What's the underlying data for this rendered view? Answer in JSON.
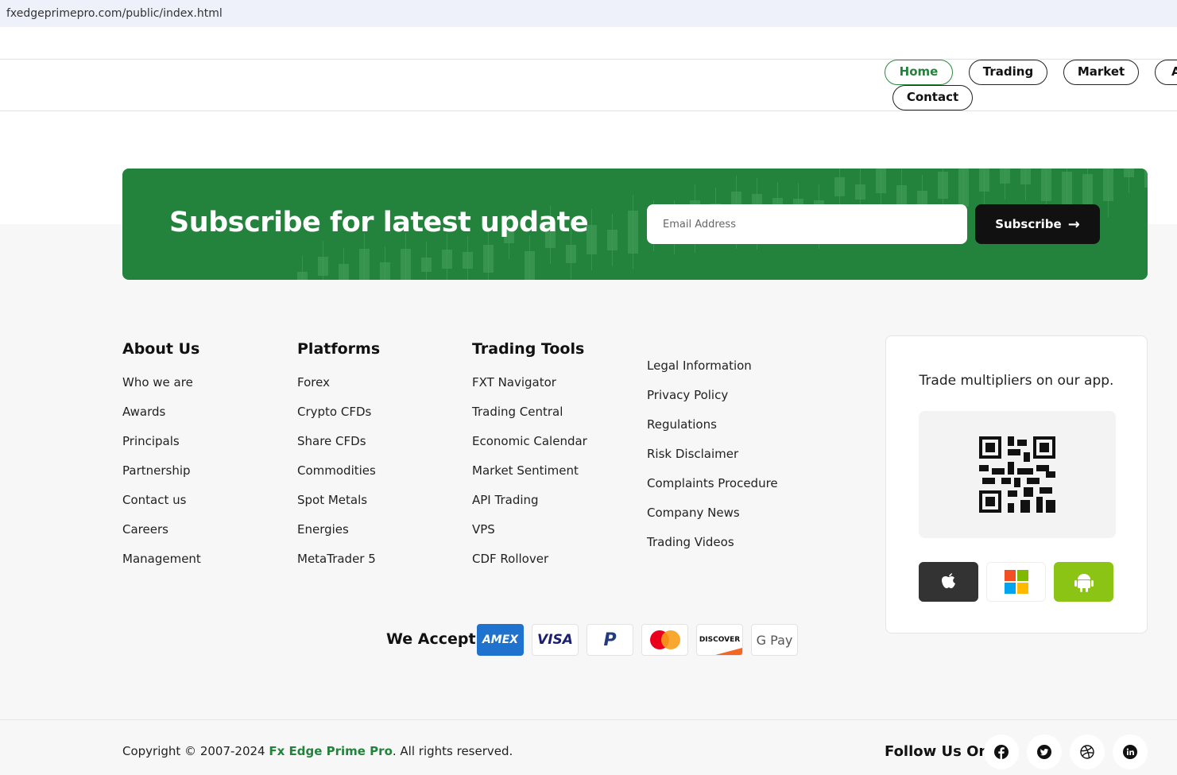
{
  "browser": {
    "url": "fxedgeprimepro.com/public/index.html"
  },
  "nav": [
    {
      "label": "Home",
      "active": true
    },
    {
      "label": "Trading"
    },
    {
      "label": "Market"
    },
    {
      "label": "A"
    },
    {
      "label": "Contact"
    }
  ],
  "subscribe": {
    "title": "Subscribe for latest update",
    "placeholder": "Email Address",
    "button": "Subscribe"
  },
  "footer": {
    "columns": [
      {
        "heading": "About Us",
        "items": [
          "Who we are",
          "Awards",
          "Principals",
          "Partnership",
          "Contact us",
          "Careers",
          "Management"
        ]
      },
      {
        "heading": "Platforms",
        "items": [
          "Forex",
          "Crypto CFDs",
          "Share CFDs",
          "Commodities",
          "Spot Metals",
          "Energies",
          "MetaTrader 5"
        ]
      },
      {
        "heading": "Trading Tools",
        "items": [
          "FXT Navigator",
          "Trading Central",
          "Economic Calendar",
          "Market Sentiment",
          "API Trading",
          "VPS",
          "CDF Rollover"
        ]
      },
      {
        "heading": "",
        "items": [
          "Legal Information",
          "Privacy Policy",
          "Regulations",
          "Risk Disclaimer",
          "Complaints Procedure",
          "Company News",
          "Trading Videos"
        ]
      }
    ],
    "app": {
      "title": "Trade multipliers on our app.",
      "stores": [
        "apple-icon",
        "windows-icon",
        "android-icon"
      ]
    },
    "accept_label": "We Accept:",
    "payments": [
      "AMEX",
      "VISA",
      "PayPal",
      "Mastercard",
      "DISCOVER",
      "G Pay"
    ],
    "copyright": {
      "prefix": "Copyright © 2007-2024 ",
      "brand": "Fx Edge Prime Pro",
      "suffix": ". All rights reserved."
    },
    "follow_label": "Follow Us On:",
    "social": [
      "facebook-icon",
      "twitter-icon",
      "dribbble-icon",
      "linkedin-icon"
    ]
  },
  "colors": {
    "brand": "#23823b",
    "dark": "#111111"
  }
}
